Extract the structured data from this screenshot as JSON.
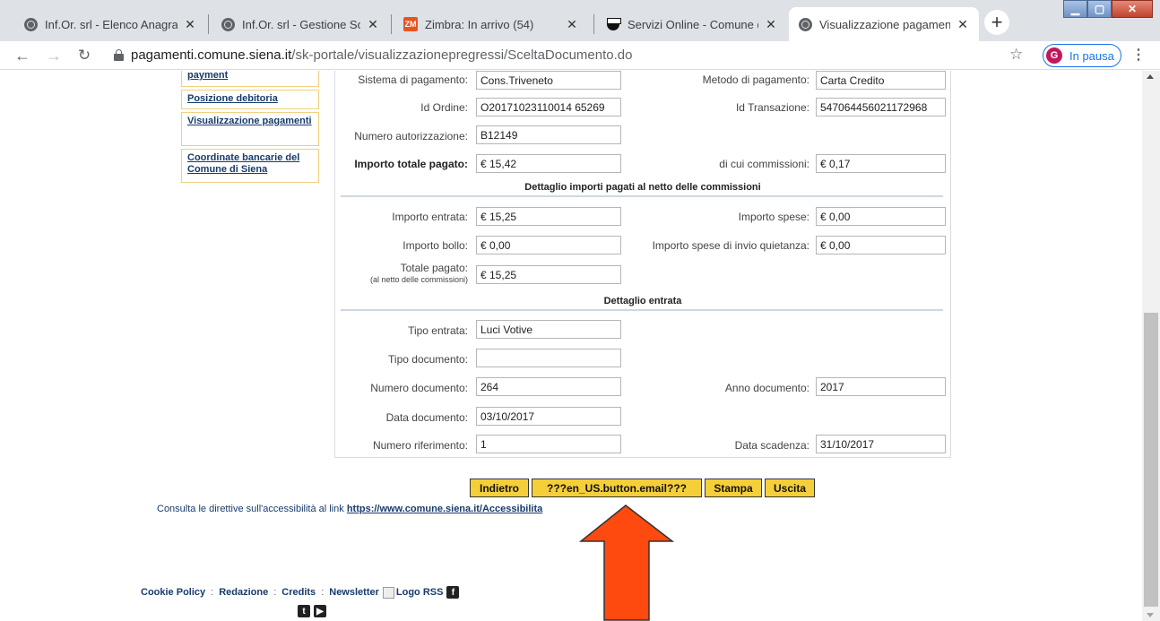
{
  "browser": {
    "tabs": [
      {
        "label": "Inf.Or. srl - Elenco Anagrafich",
        "icon": "globe-icon"
      },
      {
        "label": "Inf.Or. srl - Gestione Soggett",
        "icon": "globe-icon"
      },
      {
        "label": "Zimbra: In arrivo (54)",
        "icon": "zimbra-icon",
        "icon_text": "ZM"
      },
      {
        "label": "Servizi Online - Comune di S",
        "icon": "shield-icon"
      },
      {
        "label": "Visualizzazione pagamenti p",
        "icon": "globe-icon"
      }
    ],
    "new_tab": "+",
    "url_host": "pagamenti.comune.siena.it",
    "url_path": "/sk-portale/visualizzazionepregressi/SceltaDocumento.do",
    "profile_initial": "G",
    "profile_label": "In pausa"
  },
  "menu": [
    {
      "label": "payment"
    },
    {
      "label": "Posizione debitoria"
    },
    {
      "label": "Visualizzazione pagamenti"
    },
    {
      "label": "Coordinate bancarie del Comune di Siena"
    }
  ],
  "payment": {
    "sistema_label": "Sistema di pagamento:",
    "sistema_value": "Cons.Triveneto",
    "metodo_label": "Metodo di pagamento:",
    "metodo_value": "Carta Credito",
    "id_ordine_label": "Id Ordine:",
    "id_ordine_value": "O20171023110014 65269",
    "id_transazione_label": "Id Transazione:",
    "id_transazione_value": "547064456021172968",
    "autorizzazione_label": "Numero autorizzazione:",
    "autorizzazione_value": "B12149",
    "totale_label": "Importo totale pagato:",
    "totale_value": "€ 15,42",
    "commissioni_label": "di cui commissioni:",
    "commissioni_value": "€ 0,17"
  },
  "section_net": {
    "title": "Dettaglio importi pagati al netto delle commissioni",
    "entrata_label": "Importo entrata:",
    "entrata_value": "€ 15,25",
    "spese_label": "Importo spese:",
    "spese_value": "€ 0,00",
    "bollo_label": "Importo bollo:",
    "bollo_value": "€ 0,00",
    "invio_label": "Importo spese di invio quietanza:",
    "invio_value": "€ 0,00",
    "totale_label": "Totale pagato:",
    "totale_sub": "(al netto delle commissioni)",
    "totale_value": "€ 15,25"
  },
  "section_entry": {
    "title": "Dettaglio entrata",
    "tipo_entrata_label": "Tipo entrata:",
    "tipo_entrata_value": "Luci Votive",
    "tipo_doc_label": "Tipo documento:",
    "tipo_doc_value": "",
    "num_doc_label": "Numero documento:",
    "num_doc_value": "264",
    "anno_label": "Anno documento:",
    "anno_value": "2017",
    "data_doc_label": "Data documento:",
    "data_doc_value": "03/10/2017",
    "num_rif_label": "Numero riferimento:",
    "num_rif_value": "1",
    "scadenza_label": "Data scadenza:",
    "scadenza_value": "31/10/2017"
  },
  "buttons": {
    "indietro": "Indietro",
    "email": "???en_US.button.email???",
    "stampa": "Stampa",
    "uscita": "Uscita"
  },
  "accessibility": {
    "text": "Consulta le direttive sull'accessibilità al link",
    "link": "https://www.comune.siena.it/Accessibilita"
  },
  "footer": {
    "cookie": "Cookie Policy",
    "redazione": "Redazione",
    "credits": "Credits",
    "newsletter": "Newsletter",
    "rss": "Logo RSS",
    "separator": ":",
    "facebook": "f",
    "twitter": "t",
    "youtube": "▶"
  },
  "colors": {
    "button_bg": "#f5cf3a",
    "link": "#173b6b",
    "arrow": "#ff4a0f",
    "arrow_stroke": "#333333"
  }
}
